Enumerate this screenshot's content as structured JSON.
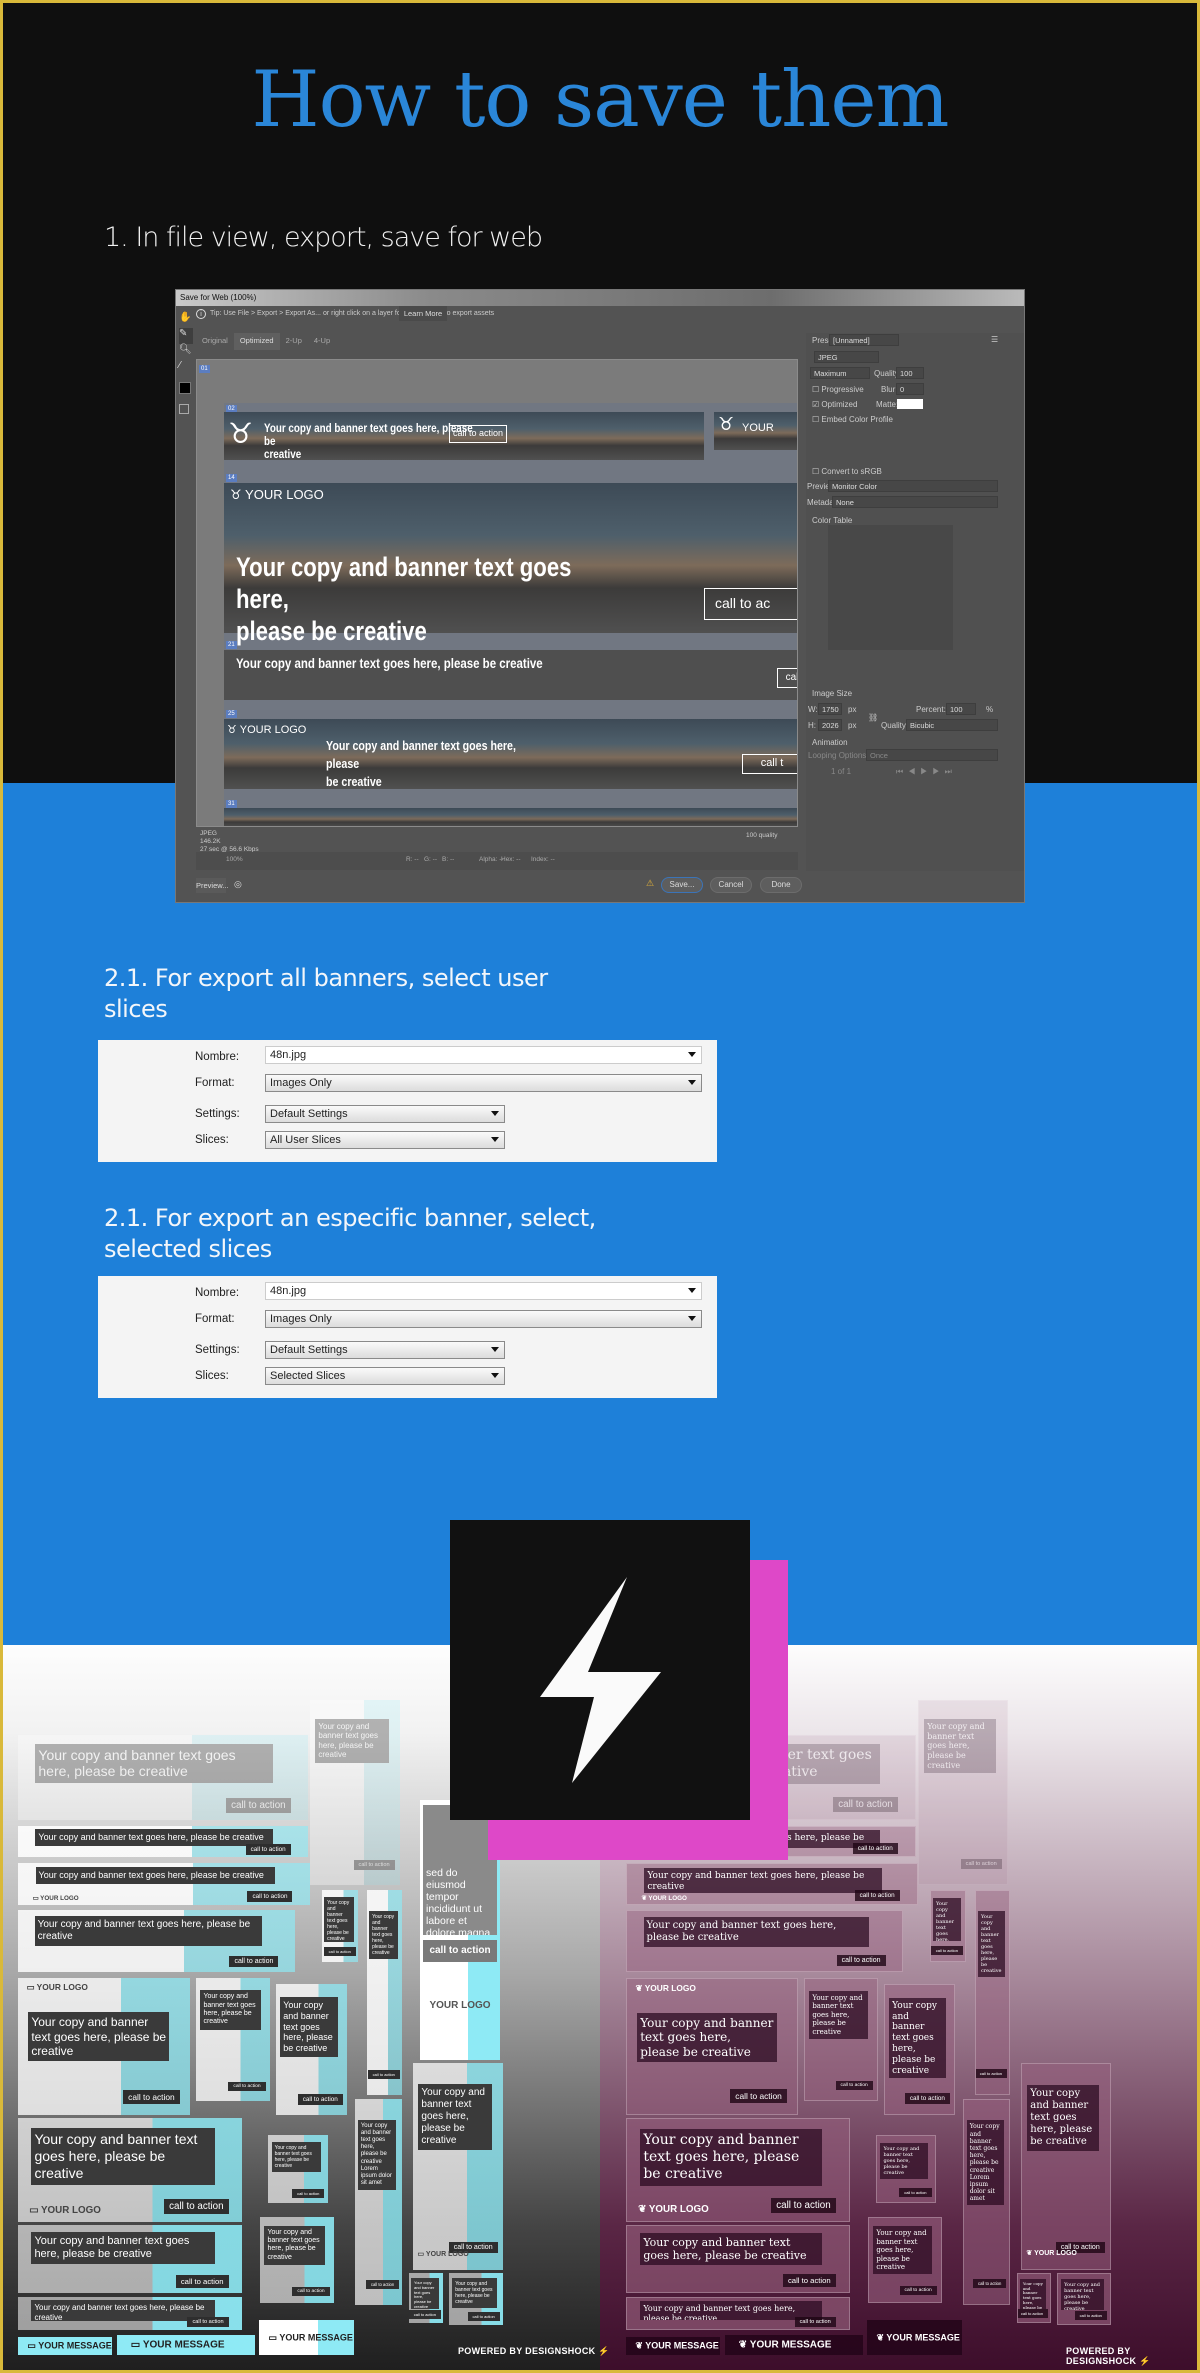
{
  "header": {
    "title": "How to save them",
    "step1": "1. In file view, export, save for web"
  },
  "dialog": {
    "window_title": "Save for Web (100%)",
    "tip": "Tip: Use File > Export > Export As... or right click on a layer for a faster way to export assets",
    "learn_more": "Learn More",
    "tabs": [
      "Original",
      "Optimized",
      "2-Up",
      "4-Up"
    ],
    "active_tab": "Optimized",
    "canvas": {
      "banner_copy_long": "Your copy and banner text goes here, please be creative",
      "banner_copy_wrap1": "Your copy and banner text goes here,",
      "banner_copy_wrap2": "please be creative",
      "banner_copy_a1": "Your copy and banner text goes here, please be",
      "banner_copy_a2": "creative",
      "banner_copy_b1": "Your copy and banner text goes here, please",
      "banner_copy_b2": "be creative",
      "cta_full": "call to action",
      "cta_cut1": "call to ac",
      "cta_cut2": "cal",
      "cta_cut3": "call t",
      "logo": "YOUR LOGO",
      "logo_cut": "YOUR",
      "slice_labels": [
        "01",
        "02",
        "03",
        "14",
        "21",
        "25",
        "31"
      ]
    },
    "info": {
      "format": "JPEG",
      "size": "146.2K",
      "time": "27 sec @ 56.6 Kbps",
      "quality": "100 quality"
    },
    "zoom": "100%",
    "readouts": [
      "R: --",
      "G: --",
      "B: --",
      "Alpha: --",
      "Hex: --",
      "Index: --"
    ],
    "buttons": {
      "preview": "Preview...",
      "save": "Save...",
      "cancel": "Cancel",
      "done": "Done"
    },
    "panel": {
      "preset_label": "Preset:",
      "preset": "[Unnamed]",
      "format": "JPEG",
      "compression": "Maximum",
      "quality_label": "Quality:",
      "quality": "100",
      "progressive": "Progressive",
      "progressive_checked": false,
      "blur_label": "Blur:",
      "blur": "0",
      "optimized": "Optimized",
      "optimized_checked": true,
      "matte_label": "Matte:",
      "embed": "Embed Color Profile",
      "embed_checked": false,
      "srgb": "Convert to sRGB",
      "srgb_checked": false,
      "preview_label": "Preview:",
      "preview": "Monitor Color",
      "metadata_label": "Metadata:",
      "metadata": "None",
      "color_table": "Color Table",
      "image_size": "Image Size",
      "w_label": "W:",
      "w": "1750",
      "h_label": "H:",
      "h": "2026",
      "unit": "px",
      "percent_label": "Percent:",
      "percent": "100",
      "percent_unit": "%",
      "resample_label": "Quality:",
      "resample": "Bicubic",
      "animation": "Animation",
      "looping_label": "Looping Options:",
      "looping": "Once",
      "frame": "1 of 1"
    }
  },
  "section2a": {
    "heading": "2.1. For export all banners, select user slices",
    "fields": {
      "name_label": "Nombre:",
      "name": "48n.jpg",
      "format_label": "Format:",
      "format": "Images Only",
      "settings_label": "Settings:",
      "settings": "Default Settings",
      "slices_label": "Slices:",
      "slices": "All User Slices"
    }
  },
  "section2b": {
    "heading": "2.1. For export an especific banner, select, selected slices",
    "fields": {
      "name_label": "Nombre:",
      "name": "48n.jpg",
      "format_label": "Format:",
      "format": "Images Only",
      "settings_label": "Settings:",
      "settings": "Default Settings",
      "slices_label": "Slices:",
      "slices": "Selected Slices"
    }
  },
  "showcase": {
    "copy": "Your copy and banner text goes here, please be creative",
    "copy_lorem": "Your copy and banner text goes here, please be creative Lorem ipsum dolor sit amet",
    "lorem_fragment": "sed do eiusmod tempor incididunt ut labore et dolore magna aliqua",
    "cta": "call to action",
    "logo": "YOUR LOGO",
    "message": "YOUR MESSAGE",
    "powered": "POWERED BY DESIGNSHOCK",
    "badge_icon": "lightning-bolt",
    "colors": {
      "accent_cyan": "#8eeaf5",
      "badge_pink": "#de48c8",
      "badge_black": "#111111",
      "brand_blue": "#2a86d8"
    }
  }
}
